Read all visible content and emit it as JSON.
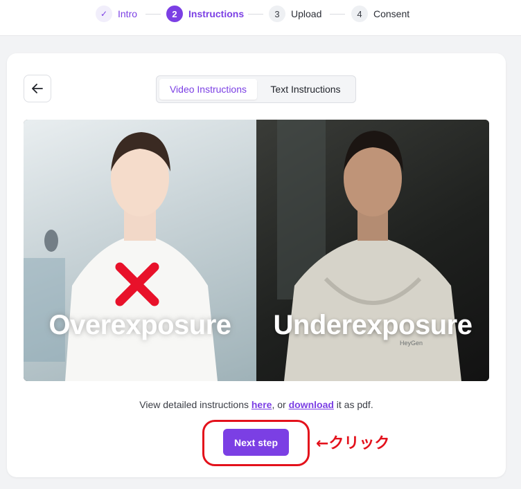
{
  "stepper": {
    "steps": [
      {
        "num": "✓",
        "label": "Intro",
        "state": "done"
      },
      {
        "num": "2",
        "label": "Instructions",
        "state": "active"
      },
      {
        "num": "3",
        "label": "Upload",
        "state": "pending"
      },
      {
        "num": "4",
        "label": "Consent",
        "state": "pending"
      }
    ]
  },
  "card": {
    "back_icon": "arrow-left-icon",
    "tabs": [
      {
        "label": "Video Instructions",
        "active": true
      },
      {
        "label": "Text Instructions",
        "active": false
      }
    ],
    "video": {
      "left_caption": "Overexposure",
      "right_caption": "Underexposure",
      "left_mark": "cross-icon",
      "hoodie_brand": "HeyGen"
    },
    "instructions": {
      "prefix": "View detailed instructions ",
      "link_here": "here",
      "middle": ", or ",
      "link_download": "download",
      "suffix": " it as pdf."
    },
    "next_button": "Next step",
    "annotation": "←クリック"
  },
  "colors": {
    "accent": "#7b3fe4",
    "annotation_red": "#e3111b",
    "cross_red": "#e8112a",
    "background": "#f2f3f5"
  }
}
